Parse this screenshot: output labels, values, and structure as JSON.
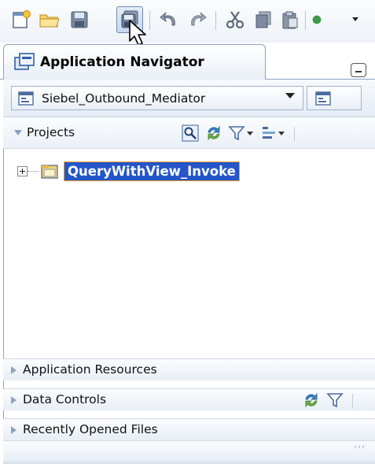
{
  "toolbar": {
    "buttons": [
      {
        "name": "new-icon"
      },
      {
        "name": "open-folder-icon"
      },
      {
        "name": "save-icon"
      },
      {
        "name": "save-all-icon",
        "pressed": true
      },
      {
        "name": "undo-icon"
      },
      {
        "name": "redo-icon"
      },
      {
        "name": "cut-icon"
      },
      {
        "name": "copy-icon"
      },
      {
        "name": "paste-icon"
      }
    ]
  },
  "navigator": {
    "tab_title": "Application Navigator",
    "application": "Siebel_Outbound_Mediator",
    "projects_label": "Projects",
    "tree": [
      {
        "name": "QueryWithView_Invoke",
        "selected": true,
        "expanded": false
      }
    ],
    "sections": [
      "Application Resources",
      "Data Controls",
      "Recently Opened Files"
    ]
  },
  "colors": {
    "selection": "#2455c9",
    "selection_border": "#f0a030",
    "panel_border": "#8da4c2",
    "header_gradient_end": "#e8eef6"
  }
}
